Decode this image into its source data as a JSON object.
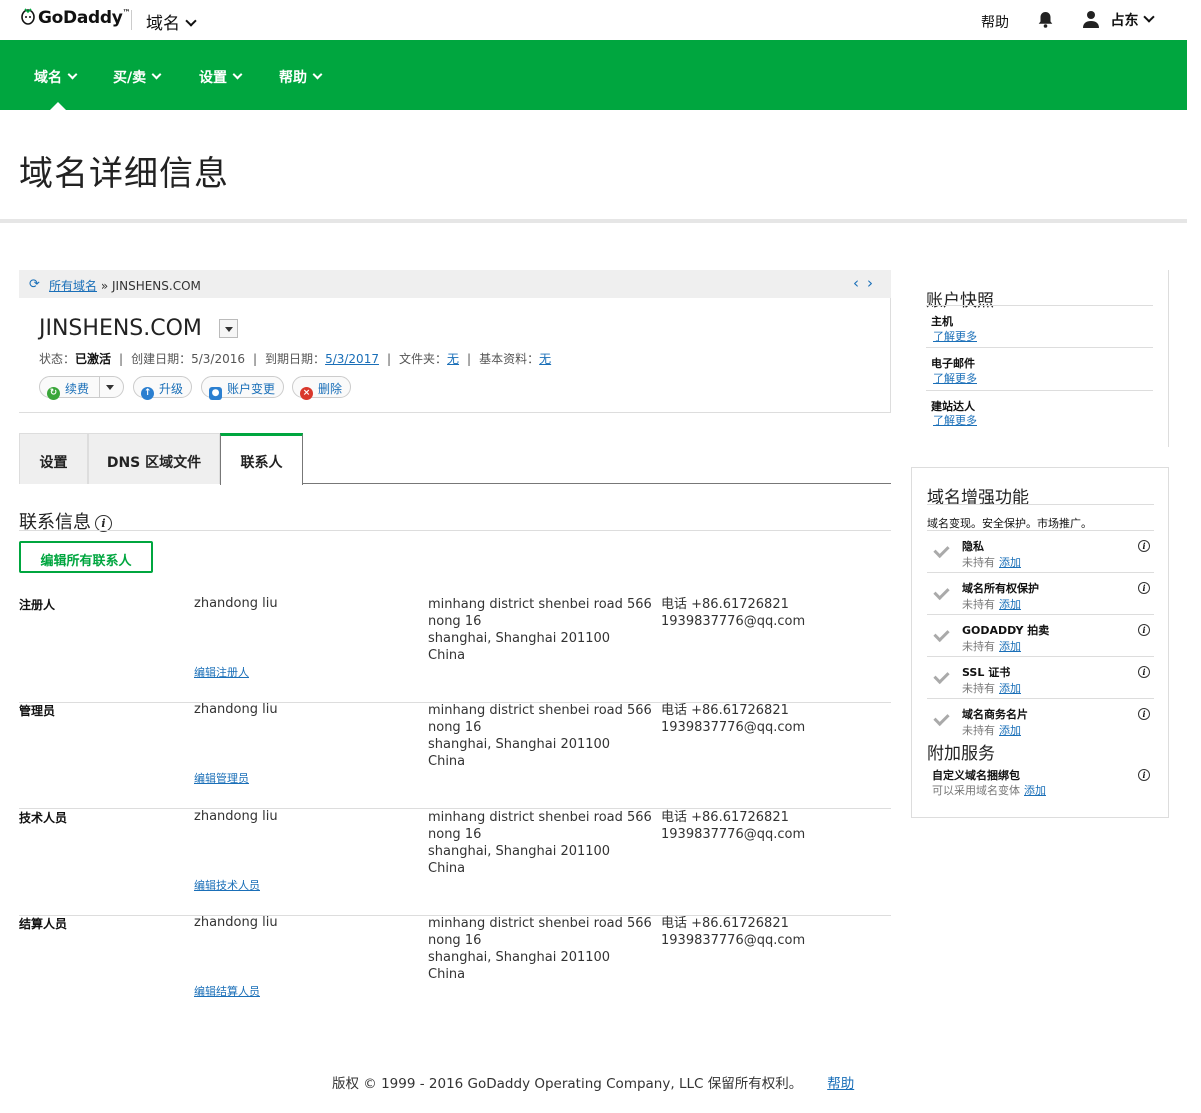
{
  "header": {
    "logo_text": "GoDaddy",
    "logo_tm": "™",
    "product_label": "域名",
    "help_label": "帮助",
    "user_name": "占东"
  },
  "nav": {
    "items": [
      "域名",
      "买/卖",
      "设置",
      "帮助"
    ]
  },
  "page_title": "域名详细信息",
  "breadcrumb": {
    "all_domains": "所有域名",
    "separator": "»",
    "current": "JINSHENS.COM"
  },
  "domain": {
    "name": "JINSHENS.COM",
    "status_label": "状态：",
    "status_value": "已激活",
    "created_label": "创建日期：",
    "created_value": "5/3/2016",
    "expires_label": "到期日期：",
    "expires_value": "5/3/2017",
    "folder_label": "文件夹：",
    "folder_value": "无",
    "profile_label": "基本资料：",
    "profile_value": "无"
  },
  "actions": {
    "renew": "续费",
    "upgrade": "升级",
    "account_change": "账户变更",
    "delete": "删除"
  },
  "tabs": [
    "设置",
    "DNS 区域文件",
    "联系人"
  ],
  "contacts_section": {
    "title": "联系信息",
    "edit_all": "编辑所有联系人",
    "rows": [
      {
        "role": "注册人",
        "name": "zhandong liu",
        "edit": "编辑注册人",
        "addr1": "minhang district shenbei road 566",
        "addr2": "nong 16",
        "addr3": "shanghai, Shanghai 201100",
        "addr4": "China",
        "phone": "电话 +86.61726821",
        "email": "1939837776@qq.com"
      },
      {
        "role": "管理员",
        "name": "zhandong liu",
        "edit": "编辑管理员",
        "addr1": "minhang district shenbei road 566",
        "addr2": "nong 16",
        "addr3": "shanghai, Shanghai 201100",
        "addr4": "China",
        "phone": "电话 +86.61726821",
        "email": "1939837776@qq.com"
      },
      {
        "role": "技术人员",
        "name": "zhandong liu",
        "edit": "编辑技术人员",
        "addr1": "minhang district shenbei road 566",
        "addr2": "nong 16",
        "addr3": "shanghai, Shanghai 201100",
        "addr4": "China",
        "phone": "电话 +86.61726821",
        "email": "1939837776@qq.com"
      },
      {
        "role": "结算人员",
        "name": "zhandong liu",
        "edit": "编辑结算人员",
        "addr1": "minhang district shenbei road 566",
        "addr2": "nong 16",
        "addr3": "shanghai, Shanghai 201100",
        "addr4": "China",
        "phone": "电话 +86.61726821",
        "email": "1939837776@qq.com"
      }
    ]
  },
  "snapshot": {
    "title": "账户快照",
    "items": [
      {
        "title": "主机",
        "link": "了解更多"
      },
      {
        "title": "电子邮件",
        "link": "了解更多"
      },
      {
        "title": "建站达人",
        "link": "了解更多"
      }
    ]
  },
  "enhancements": {
    "title": "域名增强功能",
    "desc": "域名变现。安全保护。市场推广。",
    "features": [
      {
        "title": "隐私",
        "status": "未持有",
        "link": "添加"
      },
      {
        "title": "域名所有权保护",
        "status": "未持有",
        "link": "添加"
      },
      {
        "title": "GODADDY 拍卖",
        "status": "未持有",
        "link": "添加"
      },
      {
        "title": "SSL 证书",
        "status": "未持有",
        "link": "添加"
      },
      {
        "title": "域名商务名片",
        "status": "未持有",
        "link": "添加"
      }
    ],
    "addon_title": "附加服务",
    "addon": {
      "title": "自定义域名捆绑包",
      "status": "可以采用域名变体",
      "link": "添加"
    }
  },
  "footer": {
    "copyright": "版权 ©  1999 - 2016 GoDaddy Operating Company, LLC 保留所有权利。",
    "help": "帮助"
  },
  "colors": {
    "brand_green": "#00a63f",
    "link_blue": "#1a6fb8"
  }
}
